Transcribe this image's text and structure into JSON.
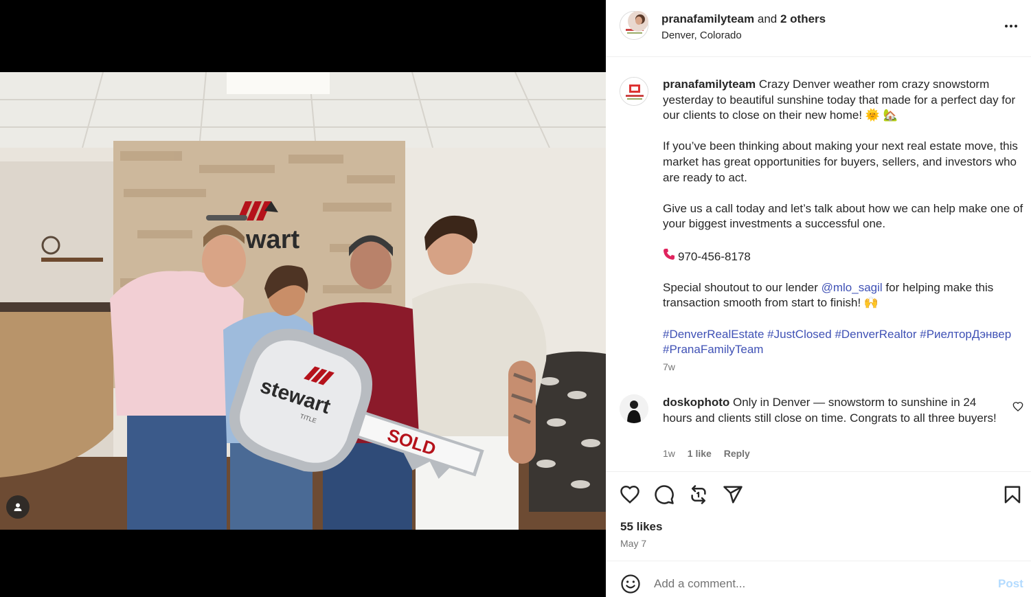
{
  "header": {
    "username": "pranafamilyteam",
    "joiner": "and",
    "others": "2 others",
    "location": "Denver, Colorado"
  },
  "caption": {
    "username": "pranafamilyteam",
    "line1": "Crazy Denver weather rom crazy snowstorm yesterday to beautiful sunshine today that made for a perfect day for our clients to close on their new home! 🌞 🏡",
    "para2": "If you’ve been thinking about making your next real estate move, this market has great opportunities for buyers, sellers, and investors who are ready to act.",
    "para3": "Give us a call today and let’s talk about how we can help make one of your biggest investments a successful one.",
    "phone": "970-456-8178",
    "shoutout_pre": "Special shoutout to our lender",
    "mention": "@mlo_sagil",
    "shoutout_post": "for helping make this transaction smooth from start to finish! 🙌",
    "hashtags": [
      "#DenverRealEstate",
      "#JustClosed",
      "#DenverRealtor",
      "#РиелторДэнвер",
      "#PranaFamilyTeam"
    ],
    "time": "7w"
  },
  "comment": {
    "username": "doskophoto",
    "text": "Only in Denver — snowstorm to sunshine in 24 hours and clients still close on time. Congrats to all three buyers!",
    "time": "1w",
    "likes": "1 like",
    "reply": "Reply"
  },
  "photo": {
    "sign_brand": "stewart",
    "sign_sub": "TITLE",
    "key_label": "SOLD",
    "wall_brand": "wart"
  },
  "post": {
    "likes": "55 likes",
    "date": "May 7"
  },
  "composer": {
    "placeholder": "Add a comment...",
    "post_label": "Post"
  },
  "icons": [
    "more-icon",
    "heart-icon",
    "comment-icon",
    "repost-icon",
    "share-icon",
    "bookmark-icon",
    "emoji-icon",
    "phone-icon",
    "user-tag-icon"
  ],
  "colors": {
    "link": "#3f51b5",
    "post_button": "#b3dbff",
    "muted": "#737373",
    "brand_red": "#b5121b"
  }
}
